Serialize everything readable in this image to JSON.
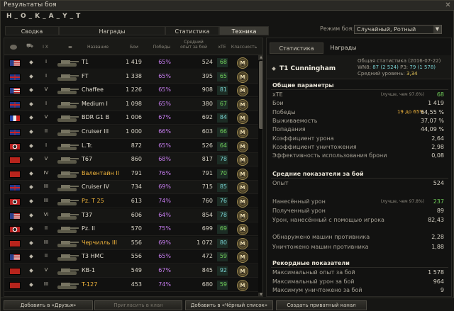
{
  "window": {
    "title": "Результаты боя",
    "player": "H_O_K_A_Y_T"
  },
  "tabs": [
    {
      "label": "Сводка"
    },
    {
      "label": "Награды"
    },
    {
      "label": "Статистика"
    },
    {
      "label": "Техника"
    }
  ],
  "battle_mode": {
    "label": "Режим боя:",
    "value": "Случайный, Ротный"
  },
  "table": {
    "headers": [
      "Название",
      "Бои",
      "Победы",
      "Средний опыт за бой",
      "xTE",
      "Классность"
    ],
    "rows": [
      {
        "flag": "usa",
        "level": "I",
        "name": "T1",
        "battles": "1 419",
        "wins": "65%",
        "xp": "524",
        "xte": "68",
        "xte_color": "#71d15a",
        "mastery": "M",
        "premium": false
      },
      {
        "flag": "uk",
        "level": "I",
        "name": "FT",
        "battles": "1 338",
        "wins": "65%",
        "xp": "395",
        "xte": "65",
        "xte_color": "#71d15a",
        "mastery": "M",
        "premium": false
      },
      {
        "flag": "usa",
        "level": "V",
        "name": "Chaffee",
        "battles": "1 226",
        "wins": "65%",
        "xp": "908",
        "xte": "81",
        "xte_color": "#78cfd0",
        "mastery": "M",
        "premium": false
      },
      {
        "flag": "uk",
        "level": "I",
        "name": "Medium I",
        "battles": "1 098",
        "wins": "65%",
        "xp": "380",
        "xte": "67",
        "xte_color": "#71d15a",
        "mastery": "M",
        "premium": false
      },
      {
        "flag": "fr",
        "level": "V",
        "name": "BDR G1 B",
        "battles": "1 006",
        "wins": "67%",
        "xp": "692",
        "xte": "84",
        "xte_color": "#78cfd0",
        "mastery": "M",
        "premium": false
      },
      {
        "flag": "uk",
        "level": "II",
        "name": "Cruiser III",
        "battles": "1 000",
        "wins": "66%",
        "xp": "603",
        "xte": "66",
        "xte_color": "#71d15a",
        "mastery": "M",
        "premium": false
      },
      {
        "flag": "ger",
        "level": "I",
        "name": "L.Tr.",
        "battles": "872",
        "wins": "65%",
        "xp": "526",
        "xte": "64",
        "xte_color": "#71d15a",
        "mastery": "M",
        "premium": false
      },
      {
        "flag": "ussr",
        "level": "V",
        "name": "T67",
        "battles": "860",
        "wins": "68%",
        "xp": "817",
        "xte": "78",
        "xte_color": "#78cfd0",
        "mastery": "M",
        "premium": false
      },
      {
        "flag": "ussr",
        "level": "IV",
        "name": "Валентайн II",
        "battles": "791",
        "wins": "76%",
        "xp": "791",
        "xte": "70",
        "xte_color": "#71d15a",
        "mastery": "M",
        "premium": true
      },
      {
        "flag": "uk",
        "level": "III",
        "name": "Cruiser IV",
        "battles": "734",
        "wins": "69%",
        "xp": "715",
        "xte": "85",
        "xte_color": "#78cfd0",
        "mastery": "M",
        "premium": false
      },
      {
        "flag": "ger",
        "level": "III",
        "name": "Pz. T 25",
        "battles": "613",
        "wins": "74%",
        "xp": "760",
        "xte": "76",
        "xte_color": "#78cfd0",
        "mastery": "M",
        "premium": true
      },
      {
        "flag": "usa",
        "level": "VI",
        "name": "T37",
        "battles": "606",
        "wins": "64%",
        "xp": "854",
        "xte": "78",
        "xte_color": "#78cfd0",
        "mastery": "M",
        "premium": false
      },
      {
        "flag": "ger",
        "level": "II",
        "name": "Pz. II",
        "battles": "570",
        "wins": "75%",
        "xp": "699",
        "xte": "69",
        "xte_color": "#71d15a",
        "mastery": "M",
        "premium": false
      },
      {
        "flag": "ussr",
        "level": "III",
        "name": "Черчилль III",
        "battles": "556",
        "wins": "69%",
        "xp": "1 072",
        "xte": "80",
        "xte_color": "#78cfd0",
        "mastery": "M",
        "premium": true
      },
      {
        "flag": "usa",
        "level": "II",
        "name": "T3 HMC",
        "battles": "556",
        "wins": "65%",
        "xp": "472",
        "xte": "59",
        "xte_color": "#71d15a",
        "mastery": "M",
        "premium": false
      },
      {
        "flag": "ussr",
        "level": "V",
        "name": "КВ-1",
        "battles": "549",
        "wins": "67%",
        "xp": "845",
        "xte": "92",
        "xte_color": "#78cfd0",
        "mastery": "M",
        "premium": false
      },
      {
        "flag": "ussr",
        "level": "III",
        "name": "T-127",
        "battles": "453",
        "wins": "74%",
        "xp": "680",
        "xte": "59",
        "xte_color": "#71d15a",
        "mastery": "M",
        "premium": true
      }
    ]
  },
  "detail": {
    "tabs": [
      "Статистика",
      "Награды"
    ],
    "tank_name": "T1 Cunningham",
    "general": {
      "line1": "Общая статистика (2016-07-22)",
      "wn8_label": "WN8:",
      "wn8": "87 (2 524)",
      "r3_label": "РЗ:",
      "r3": "79 (1 578)",
      "avg_label": "Средний уровень:",
      "avg": "3,34"
    },
    "sections": {
      "main": "Общие параметры",
      "avg": "Средние показатели за бой",
      "records": "Рекордные показатели"
    },
    "main_stats": [
      {
        "label": "xTE",
        "note": "(лучше, чем 97.6%)",
        "value": "68"
      },
      {
        "label": "Бои",
        "value": "1 419"
      },
      {
        "label": "Победы",
        "extra": "19 до 65%",
        "value": "64,55 %"
      },
      {
        "label": "Выживаемость",
        "value": "37,07 %"
      },
      {
        "label": "Попадания",
        "value": "44,09 %"
      },
      {
        "label": "Коэффициент урона",
        "value": "2,64"
      },
      {
        "label": "Коэффициент уничтожения",
        "value": "2,98"
      },
      {
        "label": "Эффективность использования брони",
        "value": "0,08"
      }
    ],
    "avg_stats": [
      {
        "label": "Опыт",
        "value": "524"
      },
      {
        "label": "Нанесённый урон",
        "note": "(лучше, чем 97.8%)",
        "value": "237"
      },
      {
        "label": "Полученный урон",
        "value": "89"
      },
      {
        "label": "Урон, нанесённый с помощью игрока",
        "value": "82,43"
      },
      {
        "label": "Обнаружено машин противника",
        "value": "2,28"
      },
      {
        "label": "Уничтожено машин противника",
        "value": "1,88"
      }
    ],
    "record_stats": [
      {
        "label": "Максимальный опыт за бой",
        "value": "1 578"
      },
      {
        "label": "Максимальный урон за бой",
        "value": "964"
      },
      {
        "label": "Максимум уничтожено за бой",
        "value": "9"
      }
    ]
  },
  "bottom_buttons": [
    "Добавить в «Друзья»",
    "Пригласить в клан",
    "Добавить в «Чёрный список»",
    "Создать приватный канал"
  ]
}
